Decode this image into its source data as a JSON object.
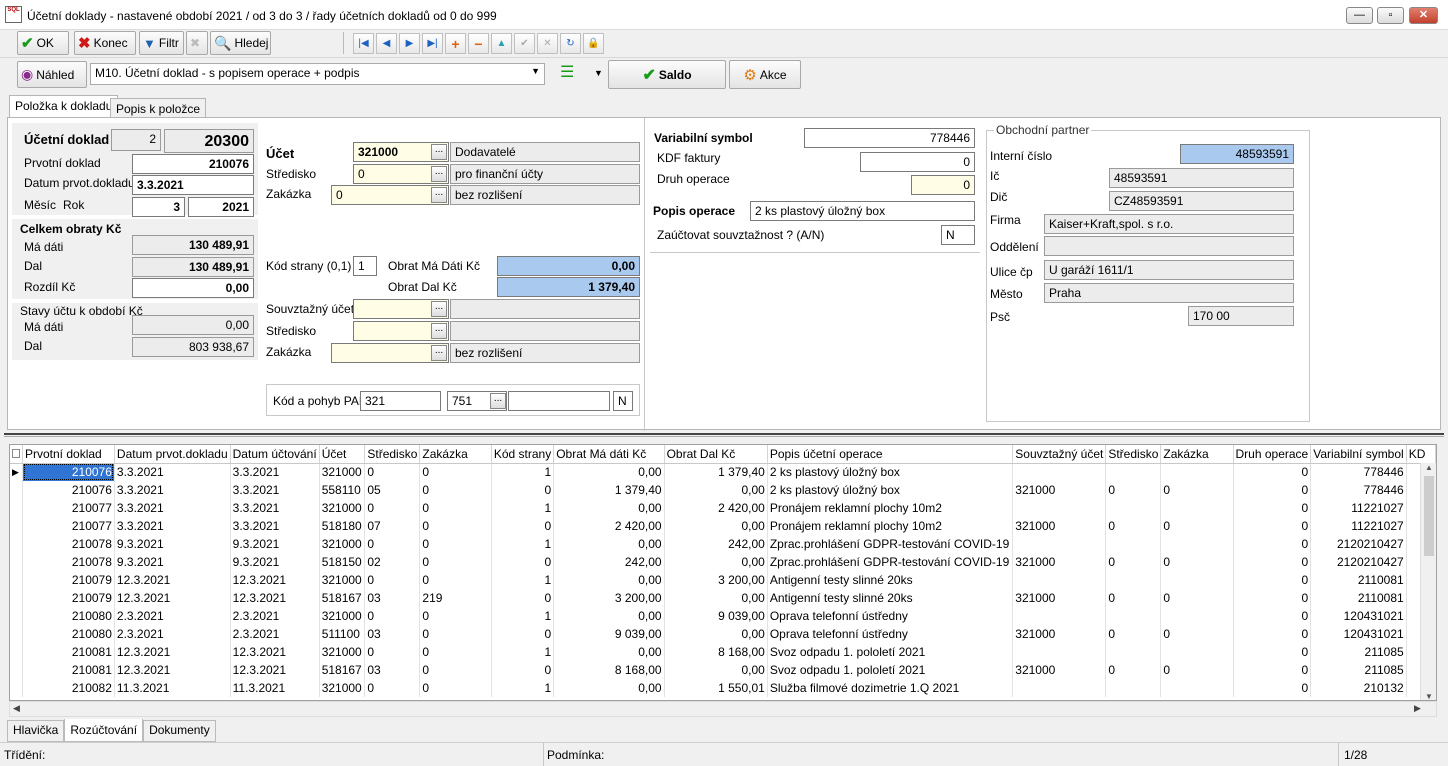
{
  "window": {
    "title": "Účetní doklady - nastavené období 2021 / od 3 do 3 / řady účetních dokladů od 0 do 999",
    "logo": "SQL"
  },
  "toolbar": {
    "ok": "OK",
    "konec": "Konec",
    "filtr": "Filtr",
    "hledej": "Hledej"
  },
  "toolbar2": {
    "nahled": "Náhled",
    "report": "M10. Účetní doklad - s popisem operace + podpis",
    "saldo": "Saldo",
    "akce": "Akce"
  },
  "tabs": {
    "polozka": "Položka k dokladu",
    "popis": "Popis k položce"
  },
  "left": {
    "ucetni_doklad_label": "Účetní doklad",
    "rada": "2",
    "cislo": "20300",
    "prvotni_label": "Prvotní doklad",
    "prvotni": "210076",
    "datum_label": "Datum prvot.dokladu",
    "datum": "3.3.2021",
    "mesic_label": "Měsíc",
    "rok_label": "Rok",
    "mesic": "3",
    "rok": "2021",
    "celkem_label": "Celkem obraty Kč",
    "ma_dati_label": "Má dáti",
    "ma_dati": "130 489,91",
    "dal_label": "Dal",
    "dal": "130 489,91",
    "rozdil_label": "Rozdíl Kč",
    "rozdil": "0,00",
    "stavy_label": "Stavy účtu k období Kč",
    "stav_md_label": "Má dáti",
    "stav_md": "0,00",
    "stav_dal_label": "Dal",
    "stav_dal": "803 938,67"
  },
  "mid": {
    "ucet_label": "Účet",
    "ucet": "321000",
    "ucet_name": "Dodavatelé",
    "stredisko_label": "Středisko",
    "stredisko": "0",
    "stredisko_name": "pro finanční účty",
    "zakazka_label": "Zakázka",
    "zakazka": "0",
    "zakazka_name": "bez rozlišení",
    "kod_strany_label": "Kód strany (0,1)",
    "kod_strany": "1",
    "obrat_md_label": "Obrat Má Dáti Kč",
    "obrat_md": "0,00",
    "obrat_dal_label": "Obrat Dal Kč",
    "obrat_dal": "1 379,40",
    "souv_ucet_label": "Souvztažný účet",
    "souv_stredisko_label": "Středisko",
    "souv_zakazka_label": "Zakázka",
    "souv_zakazka_name": "bez rozlišení",
    "pap_label": "Kód a pohyb PAP",
    "pap_kod": "321",
    "pap_pohyb": "751",
    "pap_flag": "N"
  },
  "right": {
    "vs_label": "Variabilní symbol",
    "vs": "778446",
    "kdf_label": "KDF faktury",
    "kdf": "0",
    "druh_label": "Druh operace",
    "druh": "0",
    "popis_label": "Popis operace",
    "popis": "2 ks plastový úložný box",
    "zauct_label": "Zaúčtovat souvztažnost ? (A/N)",
    "zauct": "N"
  },
  "partner": {
    "group_label": "Obchodní partner",
    "interni_label": "Interní číslo",
    "interni": "48593591",
    "ic_label": "Ič",
    "ic": "48593591",
    "dic_label": "Dič",
    "dic": "CZ48593591",
    "firma_label": "Firma",
    "firma": "Kaiser+Kraft,spol. s r.o.",
    "oddeleni_label": "Oddělení",
    "oddeleni": "",
    "ulice_label": "Ulice čp",
    "ulice": "U garáží 1611/1",
    "mesto_label": "Město",
    "mesto": "Praha",
    "psc_label": "Psč",
    "psc": "170 00"
  },
  "grid": {
    "columns": [
      "Prvotní doklad",
      "Datum prvot.dokladu",
      "Datum účtování",
      "Účet",
      "Středisko",
      "Zakázka",
      "Kód strany",
      "Obrat Má dáti Kč",
      "Obrat Dal Kč",
      "Popis účetní operace",
      "Souvztažný účet",
      "Středisko",
      "Zakázka",
      "Druh operace",
      "Variabilní symbol",
      "KD"
    ],
    "rows": [
      [
        "210076",
        "3.3.2021",
        "3.3.2021",
        "321000",
        "0",
        "0",
        "1",
        "0,00",
        "1 379,40",
        "2 ks plastový úložný box",
        "",
        "",
        "",
        "0",
        "778446"
      ],
      [
        "210076",
        "3.3.2021",
        "3.3.2021",
        "558110",
        "05",
        "0",
        "0",
        "1 379,40",
        "0,00",
        "2 ks plastový úložný box",
        "321000",
        "0",
        "0",
        "0",
        "778446"
      ],
      [
        "210077",
        "3.3.2021",
        "3.3.2021",
        "321000",
        "0",
        "0",
        "1",
        "0,00",
        "2 420,00",
        "Pronájem reklamní plochy 10m2",
        "",
        "",
        "",
        "0",
        "11221027"
      ],
      [
        "210077",
        "3.3.2021",
        "3.3.2021",
        "518180",
        "07",
        "0",
        "0",
        "2 420,00",
        "0,00",
        "Pronájem reklamní plochy 10m2",
        "321000",
        "0",
        "0",
        "0",
        "11221027"
      ],
      [
        "210078",
        "9.3.2021",
        "9.3.2021",
        "321000",
        "0",
        "0",
        "1",
        "0,00",
        "242,00",
        "Zprac.prohlášení GDPR-testování COVID-19",
        "",
        "",
        "",
        "0",
        "2120210427"
      ],
      [
        "210078",
        "9.3.2021",
        "9.3.2021",
        "518150",
        "02",
        "0",
        "0",
        "242,00",
        "0,00",
        "Zprac.prohlášení GDPR-testování COVID-19",
        "321000",
        "0",
        "0",
        "0",
        "2120210427"
      ],
      [
        "210079",
        "12.3.2021",
        "12.3.2021",
        "321000",
        "0",
        "0",
        "1",
        "0,00",
        "3 200,00",
        "Antigenní testy slinné 20ks",
        "",
        "",
        "",
        "0",
        "2110081"
      ],
      [
        "210079",
        "12.3.2021",
        "12.3.2021",
        "518167",
        "03",
        "219",
        "0",
        "3 200,00",
        "0,00",
        "Antigenní testy slinné 20ks",
        "321000",
        "0",
        "0",
        "0",
        "2110081"
      ],
      [
        "210080",
        "2.3.2021",
        "2.3.2021",
        "321000",
        "0",
        "0",
        "1",
        "0,00",
        "9 039,00",
        "Oprava telefonní ústředny",
        "",
        "",
        "",
        "0",
        "120431021"
      ],
      [
        "210080",
        "2.3.2021",
        "2.3.2021",
        "511100",
        "03",
        "0",
        "0",
        "9 039,00",
        "0,00",
        "Oprava telefonní ústředny",
        "321000",
        "0",
        "0",
        "0",
        "120431021"
      ],
      [
        "210081",
        "12.3.2021",
        "12.3.2021",
        "321000",
        "0",
        "0",
        "1",
        "0,00",
        "8 168,00",
        "Svoz odpadu 1. pololetí 2021",
        "",
        "",
        "",
        "0",
        "211085"
      ],
      [
        "210081",
        "12.3.2021",
        "12.3.2021",
        "518167",
        "03",
        "0",
        "0",
        "8 168,00",
        "0,00",
        "Svoz odpadu 1. pololetí 2021",
        "321000",
        "0",
        "0",
        "0",
        "211085"
      ],
      [
        "210082",
        "11.3.2021",
        "11.3.2021",
        "321000",
        "0",
        "0",
        "1",
        "0,00",
        "1 550,01",
        "Služba filmové dozimetrie 1.Q 2021",
        "",
        "",
        "",
        "0",
        "210132"
      ]
    ]
  },
  "bottom_tabs": [
    "Hlavička",
    "Rozúčtování",
    "Dokumenty"
  ],
  "status": {
    "trideni": "Třídění:",
    "podminka": "Podmínka:",
    "position": "1/28"
  }
}
